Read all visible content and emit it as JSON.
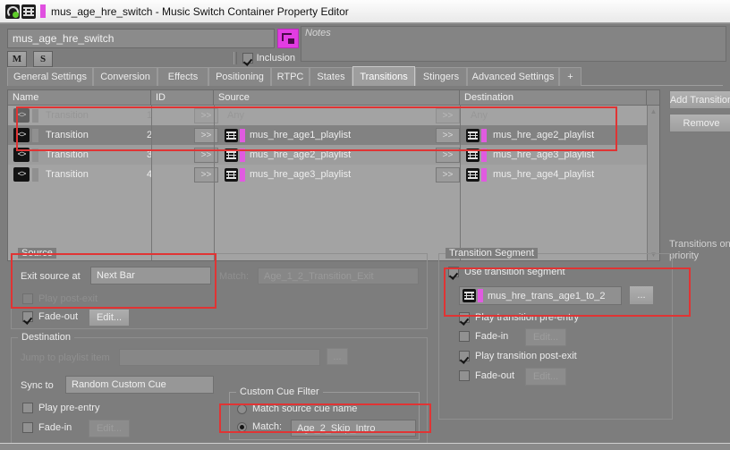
{
  "window": {
    "title": "mus_age_hre_switch - Music Switch Container Property Editor",
    "icon_music_switch": "music-switch-icon",
    "icon_switch": "switch-container-icon"
  },
  "header": {
    "name_value": "mus_age_hre_switch",
    "name_button_icon": "switch-shortcut-icon",
    "mute_label": "M",
    "solo_label": "S",
    "inclusion_label": "Inclusion",
    "inclusion_checked": true,
    "notes_placeholder": "Notes"
  },
  "tabs": [
    {
      "label": "General Settings",
      "active": false
    },
    {
      "label": "Conversion",
      "active": false
    },
    {
      "label": "Effects",
      "active": false
    },
    {
      "label": "Positioning",
      "active": false
    },
    {
      "label": "RTPC",
      "active": false
    },
    {
      "label": "States",
      "active": false
    },
    {
      "label": "Transitions",
      "active": true
    },
    {
      "label": "Stingers",
      "active": false
    },
    {
      "label": "Advanced Settings",
      "active": false
    },
    {
      "label": "+",
      "active": false
    }
  ],
  "table": {
    "columns": [
      "Name",
      "ID",
      "Source",
      "Destination"
    ],
    "rows": [
      {
        "name": "Transition",
        "id": "1",
        "source": "Any",
        "destination": "Any",
        "has_source_obj": false,
        "has_dest_obj": false,
        "state": "odd"
      },
      {
        "name": "Transition",
        "id": "2",
        "source": "mus_hre_age1_playlist",
        "destination": "mus_hre_age2_playlist",
        "has_source_obj": true,
        "has_dest_obj": true,
        "state": "sel"
      },
      {
        "name": "Transition",
        "id": "3",
        "source": "mus_hre_age2_playlist",
        "destination": "mus_hre_age3_playlist",
        "has_source_obj": true,
        "has_dest_obj": true,
        "state": "alt"
      },
      {
        "name": "Transition",
        "id": "4",
        "source": "mus_hre_age3_playlist",
        "destination": "mus_hre_age4_playlist",
        "has_source_obj": true,
        "has_dest_obj": true,
        "state": "odd"
      }
    ],
    "arrow_label": ">>"
  },
  "side": {
    "add_transition_label": "Add Transition",
    "remove_label": "Remove",
    "note": "Transitions on priority"
  },
  "source_group": {
    "legend": "Source",
    "exit_source_at_label": "Exit source at",
    "exit_source_at_value": "Next Bar",
    "match_label": "Match:",
    "match_value": "Age_1_2_Transition_Exit",
    "play_post_exit_label": "Play post-exit",
    "play_post_exit_checked": false,
    "fade_out_label": "Fade-out",
    "fade_out_checked": true,
    "fade_out_edit_label": "Edit..."
  },
  "destination_group": {
    "legend": "Destination",
    "jump_to_label": "Jump to playlist item",
    "jump_to_value": "",
    "browse_label": "...",
    "sync_to_label": "Sync to",
    "sync_to_value": "Random Custom Cue",
    "play_pre_entry_label": "Play pre-entry",
    "play_pre_entry_checked": false,
    "fade_in_label": "Fade-in",
    "fade_in_checked": false,
    "fade_in_edit_label": "Edit...",
    "cue_filter": {
      "legend": "Custom Cue Filter",
      "match_source_label": "Match source cue name",
      "match_source_selected": false,
      "match_label": "Match:",
      "match_selected": true,
      "match_value": "Age_2_Skip_Intro"
    }
  },
  "transition_segment": {
    "legend": "Transition Segment",
    "use_label": "Use transition segment",
    "use_checked": true,
    "segment_value": "mus_hre_trans_age1_to_2",
    "segment_icon": "music-segment-icon",
    "browse_label": "...",
    "play_pre_entry_label": "Play transition pre-entry",
    "play_pre_entry_checked": true,
    "fade_in_label": "Fade-in",
    "fade_in_checked": false,
    "fade_in_edit_label": "Edit...",
    "play_post_exit_label": "Play transition post-exit",
    "play_post_exit_checked": true,
    "fade_out_label": "Fade-out",
    "fade_out_checked": false,
    "fade_out_edit_label": "Edit..."
  },
  "annotations": {
    "color": "#e03434",
    "boxes": [
      "table-rows-highlight",
      "source-exit-highlight",
      "transition-segment-highlight",
      "custom-cue-match-highlight"
    ]
  }
}
